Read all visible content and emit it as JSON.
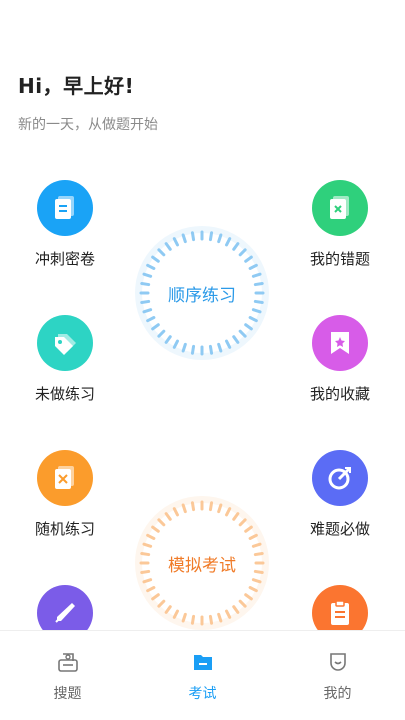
{
  "header": {
    "greeting": "Hi，早上好!",
    "subtitle": "新的一天，从做题开始"
  },
  "menu": {
    "left": [
      {
        "label": "冲刺密卷",
        "icon": "paper-icon",
        "color": "#1aa3f6"
      },
      {
        "label": "未做练习",
        "icon": "tag-icon",
        "color": "#2dd4c4"
      },
      {
        "label": "随机练习",
        "icon": "shuffle-icon",
        "color": "#fb9c2c"
      },
      {
        "label": "",
        "icon": "rocket-icon",
        "color": "#7b5ce8"
      }
    ],
    "right": [
      {
        "label": "我的错题",
        "icon": "wrong-icon",
        "color": "#2fd07c"
      },
      {
        "label": "我的收藏",
        "icon": "bookmark-icon",
        "color": "#d75ce8"
      },
      {
        "label": "难题必做",
        "icon": "target-icon",
        "color": "#5b6cf5"
      },
      {
        "label": "",
        "icon": "clipboard-icon",
        "color": "#fb7530"
      }
    ]
  },
  "rings": {
    "sequential": {
      "label": "顺序练习",
      "color": "#2b9ae8",
      "tick_color": "#8fcaf3",
      "ring_bg": "#eef7fd"
    },
    "exam": {
      "label": "模拟考试",
      "color": "#f07b28",
      "tick_color": "#fbc898",
      "ring_bg": "#fef6ee"
    }
  },
  "tabbar": {
    "tabs": [
      {
        "label": "搜题",
        "icon": "search-question-icon"
      },
      {
        "label": "考试",
        "icon": "folder-icon"
      },
      {
        "label": "我的",
        "icon": "profile-icon"
      }
    ],
    "active_index": 1,
    "active_color": "#1a9ef5"
  }
}
